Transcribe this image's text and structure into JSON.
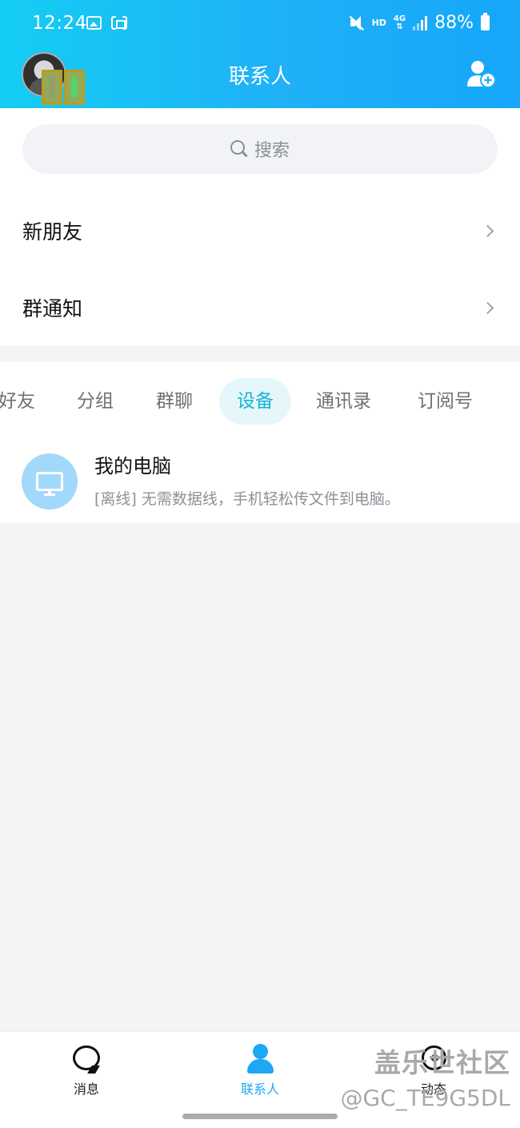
{
  "status_bar": {
    "time": "12:24",
    "hd": "HD",
    "network": "4G",
    "battery": "88%"
  },
  "header": {
    "title": "联系人"
  },
  "search": {
    "placeholder": "搜索"
  },
  "entries": [
    {
      "label": "新朋友"
    },
    {
      "label": "群通知"
    }
  ],
  "tabs": [
    {
      "label": "好友",
      "active": false
    },
    {
      "label": "分组",
      "active": false
    },
    {
      "label": "群聊",
      "active": false
    },
    {
      "label": "设备",
      "active": true
    },
    {
      "label": "通讯录",
      "active": false
    },
    {
      "label": "订阅号",
      "active": false
    }
  ],
  "devices": [
    {
      "name": "我的电脑",
      "description": "[离线] 无需数据线，手机轻松传文件到电脑。",
      "icon": "monitor-icon"
    }
  ],
  "bottom_nav": [
    {
      "label": "消息",
      "icon": "chat-bubble-icon",
      "active": false
    },
    {
      "label": "联系人",
      "icon": "person-icon",
      "active": true
    },
    {
      "label": "动态",
      "icon": "star-icon",
      "active": false
    }
  ],
  "watermark": {
    "line1": "盖乐世社区",
    "line2": "@GC_TE9G5DL"
  },
  "colors": {
    "header_gradient_start": "#14cdf4",
    "header_gradient_end": "#16a6fa",
    "accent": "#13b4d9",
    "nav_active": "#1ea7f5"
  }
}
